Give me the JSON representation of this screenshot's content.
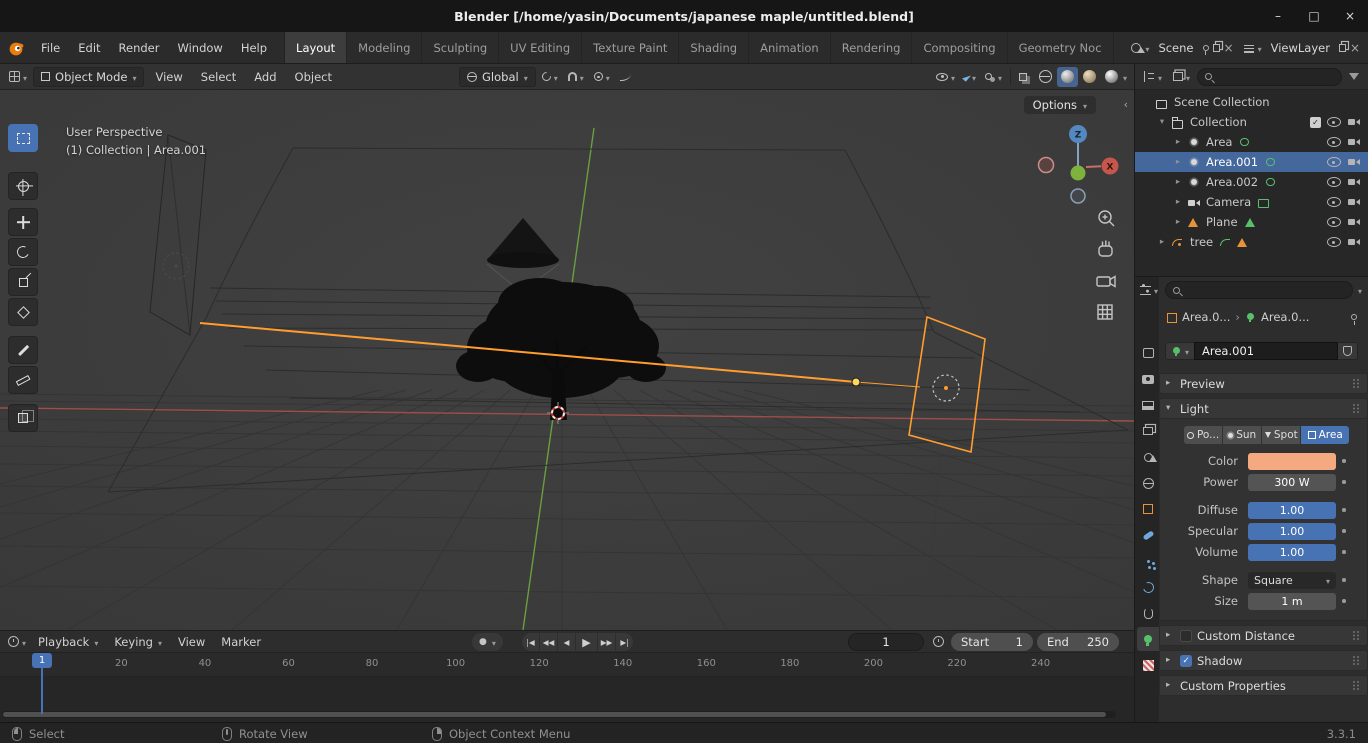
{
  "titlebar": {
    "title": "Blender [/home/yasin/Documents/japanese maple/untitled.blend]",
    "window_controls": {
      "minimize": "–",
      "maximize": "□",
      "close": "×"
    }
  },
  "topbar": {
    "app_menus": [
      "File",
      "Edit",
      "Render",
      "Window",
      "Help"
    ],
    "workspaces": [
      {
        "label": "Layout",
        "active": true
      },
      {
        "label": "Modeling"
      },
      {
        "label": "Sculpting"
      },
      {
        "label": "UV Editing"
      },
      {
        "label": "Texture Paint"
      },
      {
        "label": "Shading"
      },
      {
        "label": "Animation"
      },
      {
        "label": "Rendering"
      },
      {
        "label": "Compositing"
      },
      {
        "label": "Geometry Noc"
      }
    ],
    "scene_selector": {
      "label": "Scene"
    },
    "view_layer_selector": {
      "label": "ViewLayer"
    }
  },
  "viewport": {
    "header": {
      "mode": "Object Mode",
      "menus": [
        "View",
        "Select",
        "Add",
        "Object"
      ],
      "orientation": "Global",
      "options_button": "Options"
    },
    "overlay": {
      "line1": "User Perspective",
      "line2": "(1) Collection | Area.001"
    },
    "gizmo_axes": {
      "z": "Z",
      "x": "X"
    }
  },
  "toolbar_tools": [
    "select-box",
    "cursor",
    "move",
    "rotate",
    "scale",
    "transform",
    "annotate",
    "measure",
    "add-cube"
  ],
  "outliner": {
    "rows": [
      {
        "label": "Scene Collection",
        "icon": "scene-collection",
        "indent": 0,
        "disclosure": "none",
        "right_icons": []
      },
      {
        "label": "Collection",
        "icon": "collection",
        "indent": 1,
        "disclosure": "open",
        "right_icons": [
          "checkbox",
          "eye",
          "camera"
        ]
      },
      {
        "label": "Area",
        "icon": "area-light",
        "indent": 2,
        "disclosure": "closed",
        "data_icons": [
          "light-data"
        ],
        "right_icons": [
          "eye",
          "camera"
        ]
      },
      {
        "label": "Area.001",
        "icon": "area-light",
        "indent": 2,
        "disclosure": "closed",
        "data_icons": [
          "light-data"
        ],
        "selected": true,
        "right_icons": [
          "eye",
          "camera"
        ]
      },
      {
        "label": "Area.002",
        "icon": "area-light",
        "indent": 2,
        "disclosure": "closed",
        "data_icons": [
          "light-data"
        ],
        "right_icons": [
          "eye",
          "camera"
        ]
      },
      {
        "label": "Camera",
        "icon": "camera-object",
        "indent": 2,
        "disclosure": "closed",
        "data_icons": [
          "camera-data"
        ],
        "right_icons": [
          "eye",
          "camera"
        ]
      },
      {
        "label": "Plane",
        "icon": "mesh-object",
        "indent": 2,
        "disclosure": "closed",
        "data_icons": [
          "mesh-data"
        ],
        "right_icons": [
          "eye",
          "camera"
        ]
      },
      {
        "label": "tree",
        "icon": "curve-object",
        "indent": 1,
        "disclosure": "closed",
        "data_icons": [
          "curve-data",
          "mesh-data-orange"
        ],
        "right_icons": [
          "eye",
          "camera"
        ]
      }
    ]
  },
  "properties_tabs": [
    {
      "name": "tool"
    },
    {
      "name": "render"
    },
    {
      "name": "output"
    },
    {
      "name": "view-layer"
    },
    {
      "name": "scene"
    },
    {
      "name": "world"
    },
    {
      "name": "object"
    },
    {
      "name": "modifiers"
    },
    {
      "name": "particles"
    },
    {
      "name": "physics"
    },
    {
      "name": "constraints"
    },
    {
      "name": "object-data",
      "active": true
    },
    {
      "name": "texture"
    }
  ],
  "properties": {
    "breadcrumb": {
      "object": "Area.0...",
      "data": "Area.0..."
    },
    "name_field": "Area.001",
    "panels": {
      "preview": "Preview",
      "light": "Light",
      "custom_distance": "Custom Distance",
      "shadow": "Shadow",
      "custom_properties": "Custom Properties"
    },
    "light": {
      "types": [
        {
          "label": "Po...",
          "name": "point"
        },
        {
          "label": "Sun",
          "name": "sun"
        },
        {
          "label": "Spot",
          "name": "spot"
        },
        {
          "label": "Area",
          "name": "area",
          "active": true
        }
      ],
      "color_label": "Color",
      "color_value": "#f5a981",
      "power_label": "Power",
      "power_value": "300 W",
      "diffuse_label": "Diffuse",
      "diffuse_value": "1.00",
      "specular_label": "Specular",
      "specular_value": "1.00",
      "volume_label": "Volume",
      "volume_value": "1.00",
      "shape_label": "Shape",
      "shape_value": "Square",
      "size_label": "Size",
      "size_value": "1 m"
    }
  },
  "timeline": {
    "menus": [
      "Playback",
      "Keying",
      "View",
      "Marker"
    ],
    "record_glyph": "●",
    "transport": [
      {
        "name": "jump-to-start",
        "glyph": "|◀"
      },
      {
        "name": "jump-to-prev-keyframe",
        "glyph": "◀◀"
      },
      {
        "name": "play-reverse",
        "glyph": "◀"
      },
      {
        "name": "play",
        "glyph": "▶"
      },
      {
        "name": "jump-to-next-keyframe",
        "glyph": "▶▶"
      },
      {
        "name": "jump-to-end",
        "glyph": "▶|"
      }
    ],
    "current_frame": "1",
    "playhead_frame": "1",
    "start_label": "Start",
    "start_value": "1",
    "end_label": "End",
    "end_value": "250",
    "ticks": [
      1,
      20,
      40,
      60,
      80,
      100,
      120,
      140,
      160,
      180,
      200,
      220,
      240
    ]
  },
  "statusbar": {
    "hints": [
      {
        "mouse": "left",
        "label": "Select"
      },
      {
        "mouse": "middle",
        "label": "Rotate View"
      },
      {
        "mouse": "right",
        "label": "Object Context Menu"
      }
    ],
    "version": "3.3.1"
  },
  "colors": {
    "accent_blue": "#4772b3",
    "selection_orange": "#ff9d2e",
    "light_swatch": "#f5a981"
  }
}
